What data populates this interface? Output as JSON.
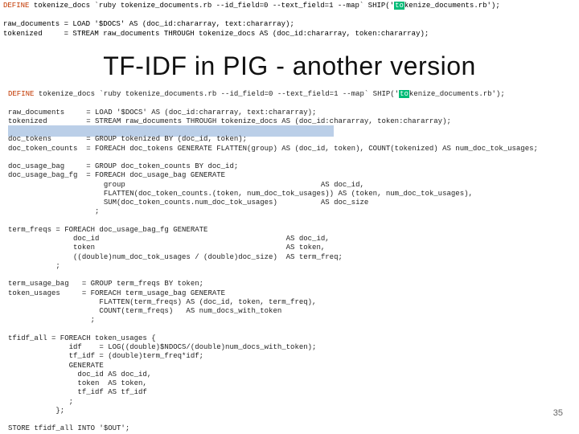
{
  "top_fragment": {
    "line1_pre": "DEFINE tokenize_docs `ruby tokenize_documents.rb --id_field=0 --text_field=1 --map` SHIP('",
    "line1_hl": "to",
    "line1_post": "kenize_documents.rb');",
    "line2": "raw_documents = LOAD '$DOCS' AS (doc_id:chararray, text:chararray);",
    "line3": "tokenized     = STREAM raw_documents THROUGH tokenize_docs AS (doc_id:chararray, token:chararray);"
  },
  "title": "TF-IDF in PIG - another version",
  "code": {
    "l01_pre": "DEFINE tokenize_docs `ruby tokenize_documents.rb --id_field=0 --text_field=1 --map` SHIP('",
    "l01_hl": "to",
    "l01_post": "kenize_documents.rb');",
    "l02": "",
    "l03": "raw_documents     = LOAD '$DOCS' AS (doc_id:chararray, text:chararray);",
    "l04": "tokenized         = STREAM raw_documents THROUGH tokenize_docs AS (doc_id:chararray, token:chararray);",
    "l05": "",
    "l06": "doc_tokens        = GROUP tokenized BY (doc_id, token);",
    "l07": "doc_token_counts  = FOREACH doc_tokens GENERATE FLATTEN(group) AS (doc_id, token), COUNT(tokenized) AS num_doc_tok_usages;",
    "l08": "",
    "l09": "doc_usage_bag     = GROUP doc_token_counts BY doc_id;",
    "l10": "doc_usage_bag_fg  = FOREACH doc_usage_bag GENERATE",
    "l11": "                      group                                             AS doc_id,",
    "l12": "                      FLATTEN(doc_token_counts.(token, num_doc_tok_usages)) AS (token, num_doc_tok_usages),",
    "l13": "                      SUM(doc_token_counts.num_doc_tok_usages)          AS doc_size",
    "l14": "                    ;",
    "l15": "",
    "l16": "term_freqs = FOREACH doc_usage_bag_fg GENERATE",
    "l17": "               doc_id                                           AS doc_id,",
    "l18": "               token                                            AS token,",
    "l19": "               ((double)num_doc_tok_usages / (double)doc_size)  AS term_freq;",
    "l20": "           ;",
    "l21": "",
    "l22": "term_usage_bag   = GROUP term_freqs BY token;",
    "l23": "token_usages     = FOREACH term_usage_bag GENERATE",
    "l24": "                     FLATTEN(term_freqs) AS (doc_id, token, term_freq),",
    "l25": "                     COUNT(term_freqs)   AS num_docs_with_token",
    "l26": "                   ;",
    "l27": "",
    "l28": "tfidf_all = FOREACH token_usages {",
    "l29": "              idf    = LOG((double)$NDOCS/(double)num_docs_with_token);",
    "l30": "              tf_idf = (double)term_freq*idf;",
    "l31": "              GENERATE",
    "l32": "                doc_id AS doc_id,",
    "l33": "                token  AS token,",
    "l34": "                tf_idf AS tf_idf",
    "l35": "              ;",
    "l36": "           };",
    "l37": "",
    "l38": "STORE tfidf_all INTO '$OUT';"
  },
  "page_number": "35"
}
